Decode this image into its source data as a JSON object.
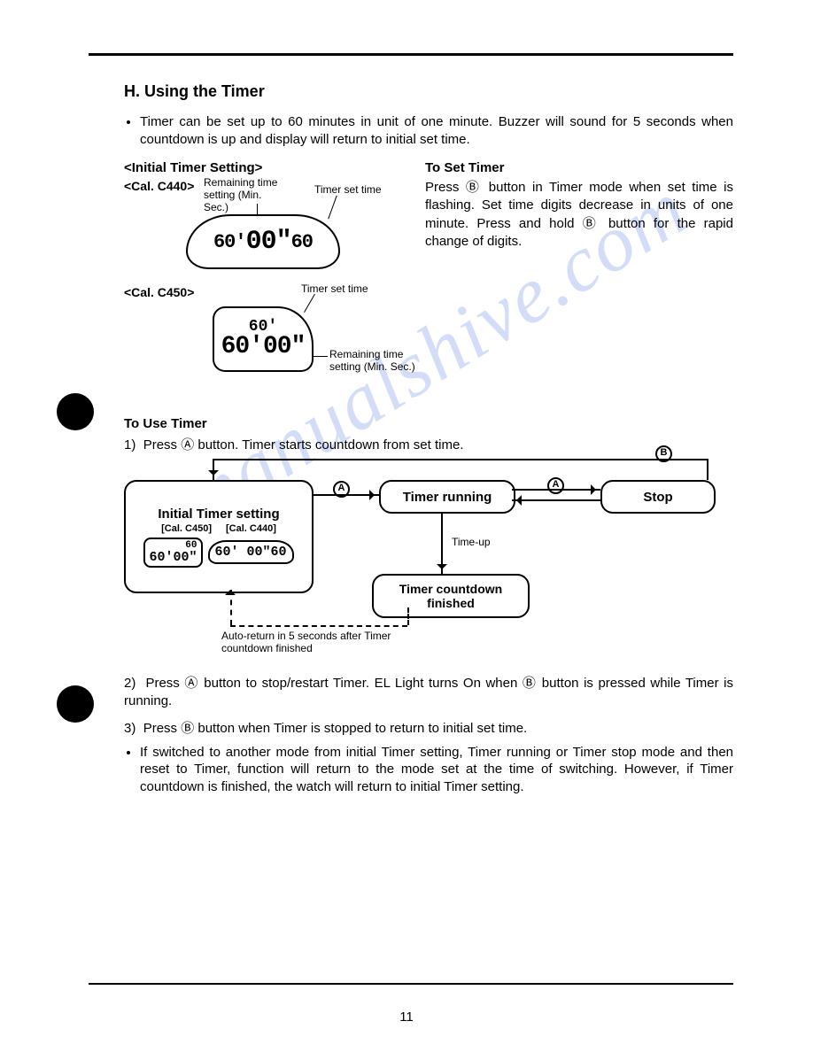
{
  "section_title": "H.  Using the Timer",
  "intro_bullet": "Timer can be set up to 60 minutes in unit of one minute. Buzzer will sound for 5 seconds when countdown is up and display will return to initial set time.",
  "left": {
    "initial_setting_head": "<Initial Timer Setting>",
    "cal_c440": "<Cal. C440>",
    "cal_c450": "<Cal. C450>",
    "callout_remaining": "Remaining time setting (Min. Sec.)",
    "callout_set_time": "Timer set time",
    "c440_digits_left": "60'",
    "c440_digits_mid": "00\"",
    "c440_digits_right": "60",
    "c450_top": "60'",
    "c450_main": "60'00\""
  },
  "right": {
    "to_set_head": "To Set Timer",
    "to_set_body": "Press Ⓑ button in Timer mode when set time is flashing. Set time digits decrease in units of one minute. Press and hold Ⓑ button for the rapid change of digits."
  },
  "to_use_head": "To Use Timer",
  "step1": "Press Ⓐ button. Timer starts countdown from set time.",
  "flow": {
    "initial": "Initial Timer setting",
    "cal_c450_lbl": "[Cal. C450]",
    "cal_c440_lbl": "[Cal. C440]",
    "mini_c450_top": "60",
    "mini_c450_main": "60'00\"",
    "mini_c440": "60' 00\"60",
    "running": "Timer running",
    "stop": "Stop",
    "finished": "Timer countdown finished",
    "timeup": "Time-up",
    "btn_a": "A",
    "btn_b": "B",
    "auto_return": "Auto-return in 5 seconds after Timer countdown finished"
  },
  "step2": "Press Ⓐ button to stop/restart Timer. EL Light turns On when Ⓑ button is pressed while Timer is running.",
  "step3": "Press Ⓑ button when Timer is stopped to return to initial set time.",
  "bullet2": "If switched to another mode from initial Timer setting, Timer running or Timer stop mode and then reset to Timer, function will return to the mode set at the time of switching. However, if Timer countdown is finished, the watch will return to initial Timer setting.",
  "watermark": "manualshive.com",
  "page_number": "11"
}
